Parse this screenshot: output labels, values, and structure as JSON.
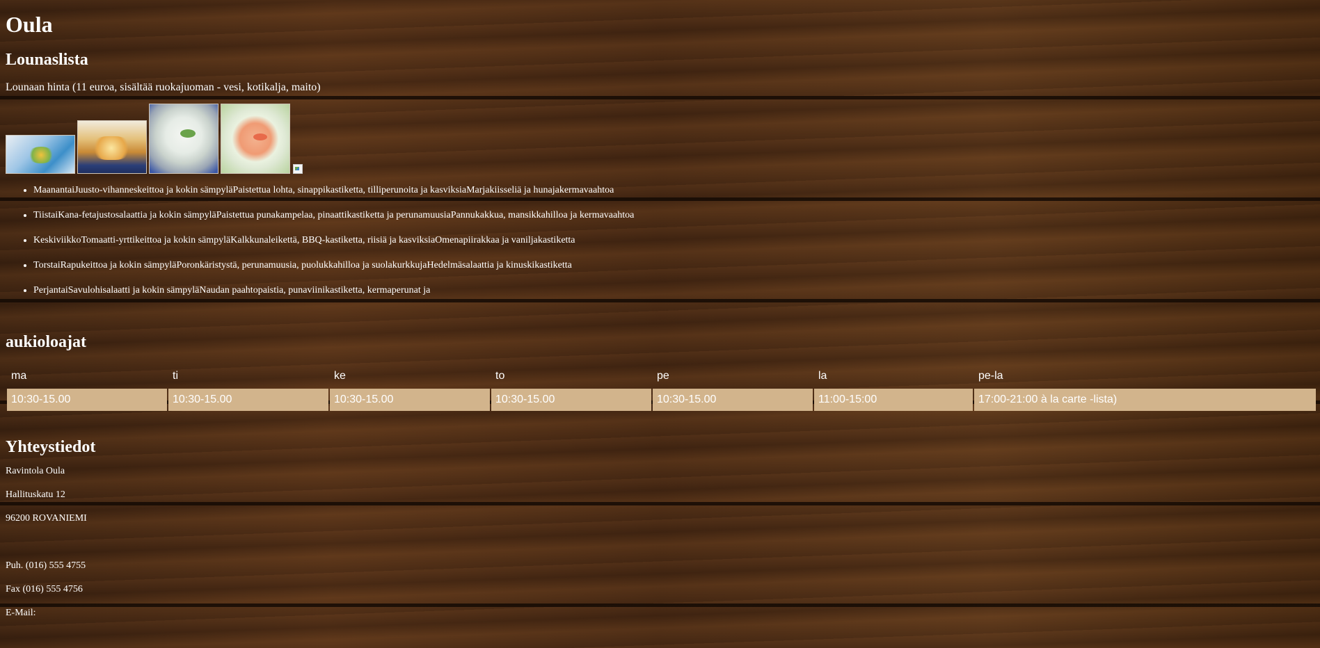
{
  "restaurant": {
    "name": "Oula"
  },
  "lunch": {
    "title": "Lounaslista",
    "price": "Lounaan hinta (11 euroa, sisältää ruokajuoman - vesi, kotikalja, maito)",
    "images": [
      "salad-dish",
      "pancake-dish",
      "cream-soup-dish",
      "tomato-soup-dish",
      "broken-image"
    ],
    "days": [
      "MaanantaiJuusto-vihanneskeittoa ja kokin sämpyläPaistettua lohta, sinappikastiketta, tilliperunoita ja kasviksiaMarjakiisseliä ja hunajakermavaahtoa",
      "TiistaiKana-fetajustosalaattia ja kokin sämpyläPaistettua punakampelaa, pinaattikastiketta ja perunamuusiaPannukakkua, mansikkahilloa ja kermavaahtoa",
      "KeskiviikkoTomaatti-yrttikeittoa ja kokin sämpyläKalkkunaleikettä, BBQ-kastiketta, riisiä ja kasviksiaOmenapiirakkaa ja vaniljakastiketta",
      "TorstaiRapukeittoa ja kokin sämpyläPoronkäristystä, perunamuusia, puolukkahilloa ja suolakurkkujaHedelmäsalaattia ja kinuskikastiketta",
      "PerjantaiSavulohisalaatti ja kokin sämpyläNaudan paahtopaistia, punaviinikastiketta, kermaperunat ja"
    ]
  },
  "hours": {
    "title": "aukioloajat",
    "headers": [
      "ma",
      "ti",
      "ke",
      "to",
      "pe",
      "la",
      "pe-la"
    ],
    "values": [
      "10:30-15.00",
      "10:30-15.00",
      "10:30-15.00",
      "10:30-15.00",
      "10:30-15.00",
      "11:00-15:00",
      "17:00-21:00 à la carte -lista)"
    ],
    "row_color": "#d2b48c"
  },
  "contact": {
    "title": "Yhteystiedot",
    "name": "Ravintola Oula",
    "street": "Hallituskatu 12",
    "city": "96200 ROVANIEMI",
    "phone": "Puh. (016) 555 4755",
    "fax": "Fax (016) 555 4756",
    "email_label": "E-Mail:"
  }
}
